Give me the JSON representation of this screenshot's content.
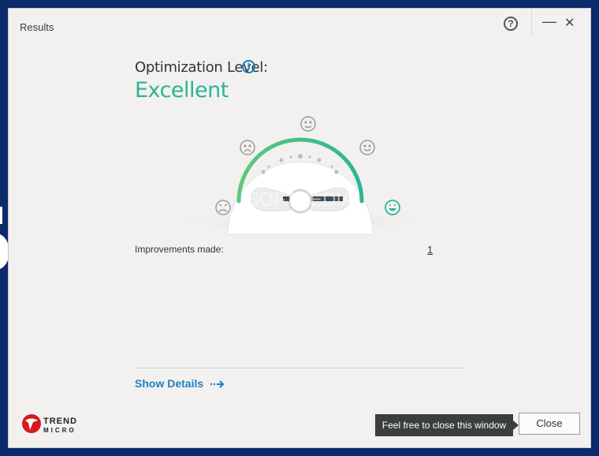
{
  "window": {
    "title": "Results",
    "help_label": "?",
    "minimize_label": "—",
    "close_label": "✕"
  },
  "summary": {
    "optimization_label": "Optimization Level:",
    "info_label": "i",
    "level": "Excellent",
    "gauge_level_fraction": 1.0,
    "accent_color": "#2bb596"
  },
  "improvements": {
    "label": "Improvements made:",
    "count": "1"
  },
  "details": {
    "link_label": "Show Details",
    "link_color": "#1d7fc3"
  },
  "brand": {
    "line1": "TREND",
    "line2": "MICRO",
    "color": "#d71920"
  },
  "footer": {
    "tooltip": "Feel free to close this window",
    "close_button": "Close"
  },
  "watermark": "SOFTPEDIA"
}
